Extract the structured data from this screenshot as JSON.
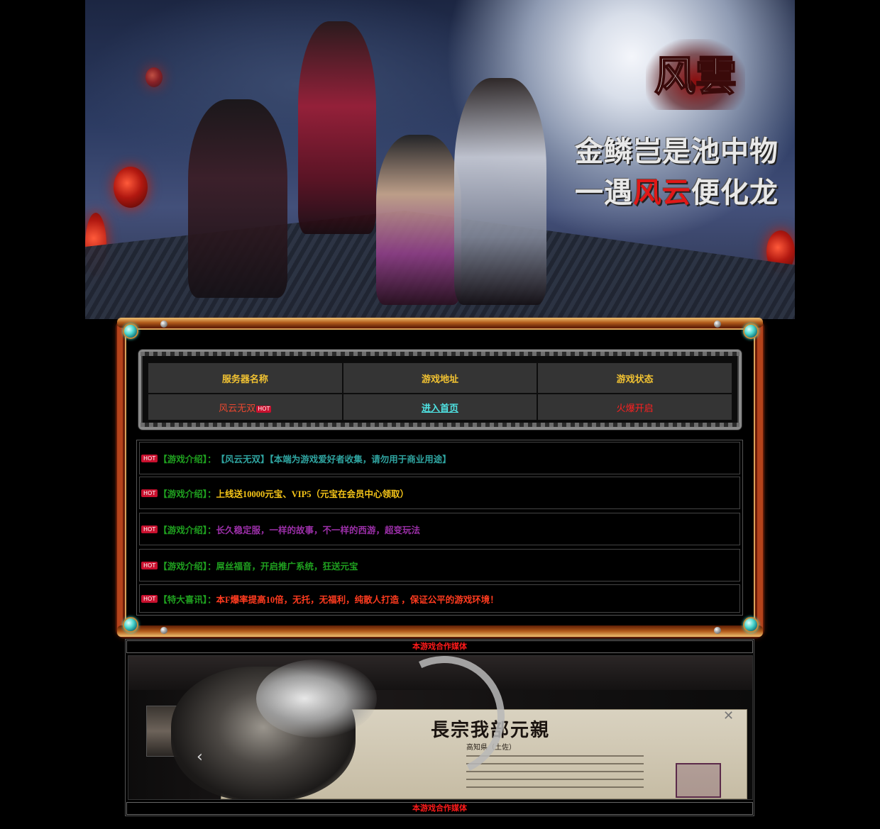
{
  "banner": {
    "logo_text": "风雲",
    "slogan_line1": "金鳞岂是池中物",
    "slogan_line2_prefix": "一遇",
    "slogan_line2_highlight": "风云",
    "slogan_line2_suffix": "便化龙"
  },
  "server_table": {
    "headers": [
      "服务器名称",
      "游戏地址",
      "游戏状态"
    ],
    "row": {
      "name": "风云无双",
      "hot_badge": "HOT",
      "link": "进入首页",
      "status": "火爆开启"
    }
  },
  "news": [
    {
      "badge": "HOT",
      "tag": "【游戏介绍】：",
      "text": "【风云无双】【本端为游戏爱好者收集，请勿用于商业用途】",
      "color": "#2fa4a0",
      "tag_color": "#1fa01f"
    },
    {
      "badge": "HOT",
      "tag": "【游戏介绍】：",
      "text": "上线送10000元宝、VIP5（元宝在会员中心领取）",
      "color": "#f5c518",
      "tag_color": "#1fa01f"
    },
    {
      "badge": "HOT",
      "tag": "【游戏介绍】：",
      "text": "长久稳定服，一样的故事，不一样的西游，超变玩法",
      "color": "#9b2fa8",
      "tag_color": "#1fa01f"
    },
    {
      "badge": "HOT",
      "tag": "【游戏介绍】：",
      "text": "屌丝福音，开启推广系统，狂送元宝",
      "color": "#1fa01f",
      "tag_color": "#1fa01f"
    },
    {
      "badge": "HOT",
      "tag": "【特大喜讯】：",
      "text": "本F爆率提高10倍，无托，无福利，纯散人打造 ，保证公平的游戏环境！",
      "color": "#ff3b1f",
      "tag_color": "#1fa01f"
    }
  ],
  "media": {
    "title_top": "本游戏合作媒体",
    "title_bottom": "本游戏合作媒体",
    "ad_title": "長宗我部元親",
    "ad_subtitle": "高知県（土佐）"
  },
  "colors": {
    "background": "#000000",
    "frame": "#b5431b",
    "header_text": "#f1c232",
    "link": "#4fe3e3",
    "status": "#ff2020",
    "media_title": "#ff1a1a"
  }
}
